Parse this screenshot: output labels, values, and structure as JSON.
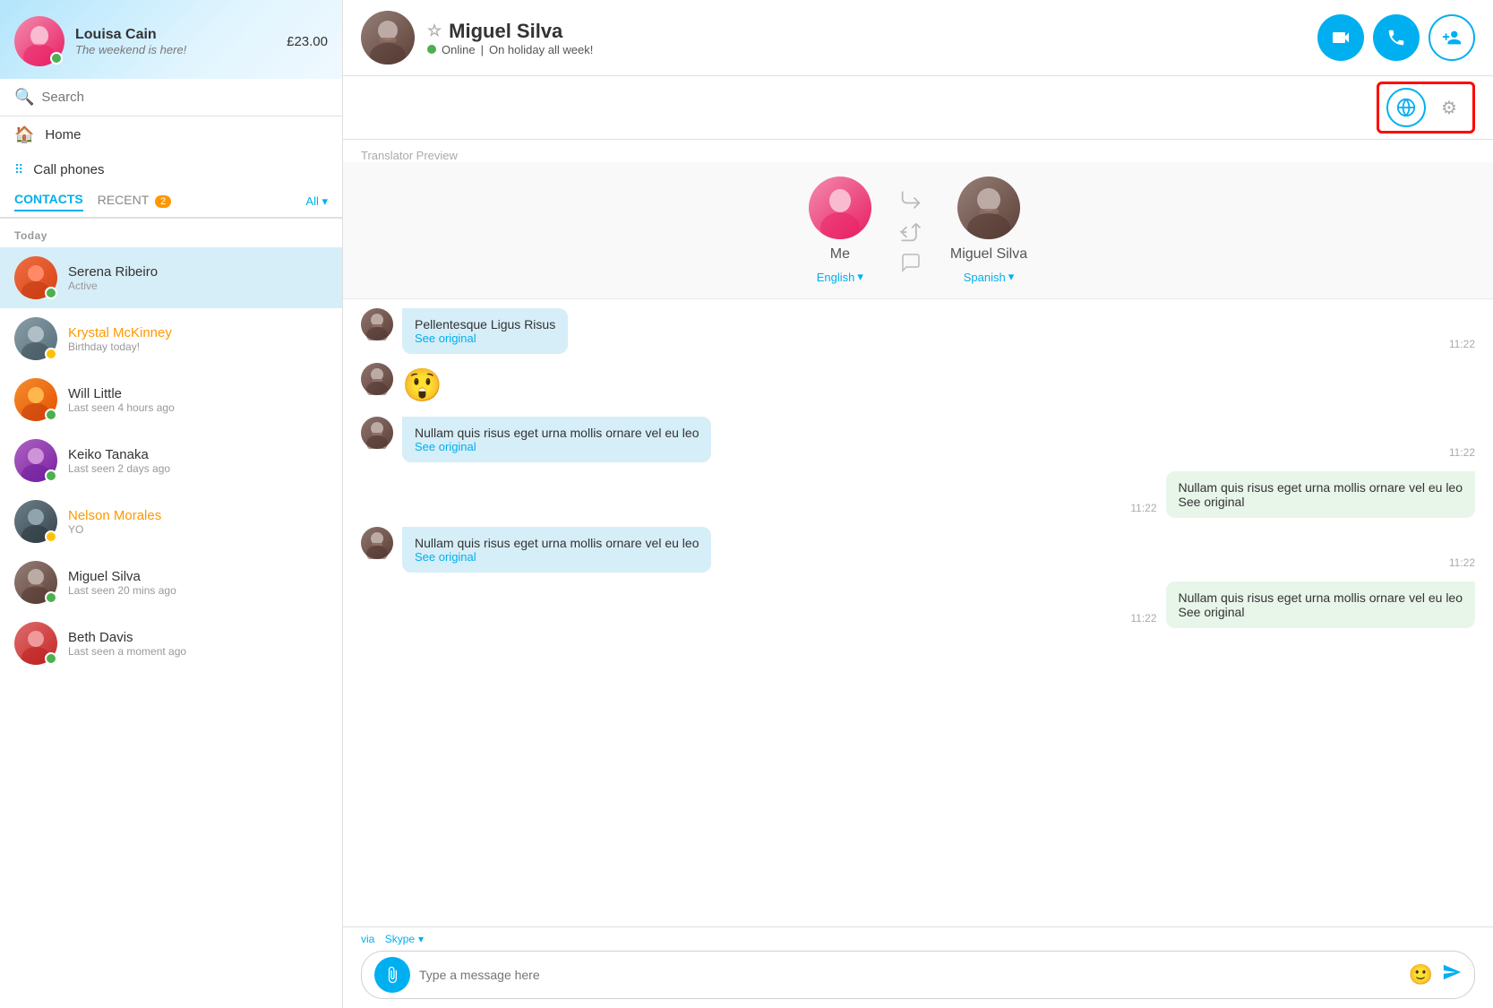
{
  "sidebar": {
    "user": {
      "name": "Louisa Cain",
      "status": "The weekend is here!",
      "balance": "£23.00"
    },
    "search": {
      "placeholder": "Search"
    },
    "nav": [
      {
        "id": "home",
        "label": "Home",
        "icon": "🏠"
      },
      {
        "id": "call-phones",
        "label": "Call phones",
        "icon": "⠿"
      }
    ],
    "tabs": [
      {
        "id": "contacts",
        "label": "CONTACTS",
        "active": true
      },
      {
        "id": "recent",
        "label": "RECENT",
        "badge": "2"
      }
    ],
    "filter_label": "All",
    "section_today": "Today",
    "contacts": [
      {
        "id": "serena",
        "name": "Serena Ribeiro",
        "sub": "Active",
        "status": "green",
        "active": true
      },
      {
        "id": "krystal",
        "name": "Krystal McKinney",
        "sub": "Birthday today!",
        "status": "yellow",
        "orange": true
      },
      {
        "id": "will",
        "name": "Will Little",
        "sub": "Last seen 4 hours ago",
        "status": "green"
      },
      {
        "id": "keiko",
        "name": "Keiko Tanaka",
        "sub": "Last seen 2 days ago",
        "status": "green"
      },
      {
        "id": "nelson",
        "name": "Nelson Morales",
        "sub": "YO",
        "status": "yellow",
        "orange": true
      },
      {
        "id": "miguel",
        "name": "Miguel Silva",
        "sub": "Last seen 20 mins ago",
        "status": "green"
      },
      {
        "id": "beth",
        "name": "Beth Davis",
        "sub": "Last seen a moment ago",
        "status": "green"
      }
    ]
  },
  "chat": {
    "contact": {
      "name": "Miguel Silva",
      "status": "Online",
      "mood": "On holiday all week!"
    },
    "translator_preview_label": "Translator Preview",
    "me": {
      "label": "Me",
      "language": "English",
      "lang_arrow": "▾"
    },
    "them": {
      "label": "Miguel Silva",
      "language": "Spanish",
      "lang_arrow": "▾"
    },
    "messages": [
      {
        "id": 1,
        "sender": "them",
        "text": "Pellentesque Ligus Risus",
        "sub": "See original",
        "time": "11:22"
      },
      {
        "id": 2,
        "sender": "them",
        "emoji": "😲",
        "time": ""
      },
      {
        "id": 3,
        "sender": "them",
        "text": "Nullam quis risus eget urna mollis ornare vel eu leo",
        "sub": "See original",
        "time": "11:22"
      },
      {
        "id": 4,
        "sender": "me",
        "text": "Nullam quis risus eget urna mollis ornare vel eu leo",
        "sub": "See original",
        "time": "11:22"
      },
      {
        "id": 5,
        "sender": "them",
        "text": "Nullam quis risus eget urna mollis ornare vel eu leo",
        "sub": "See original",
        "time": "11:22"
      },
      {
        "id": 6,
        "sender": "me",
        "text": "Nullam quis risus eget urna mollis ornare vel eu leo",
        "sub": "See original",
        "time": "11:22"
      }
    ],
    "via_label": "via",
    "via_app": "Skype",
    "input_placeholder": "Type a message here"
  },
  "icons": {
    "video_call": "📹",
    "phone_call": "📞",
    "add_contact": "👤",
    "translator": "🌐",
    "settings": "⚙",
    "search": "🔍",
    "attach": "📎",
    "emoji": "🙂",
    "send": "➤",
    "star": "☆",
    "chevron_down": "▾"
  }
}
